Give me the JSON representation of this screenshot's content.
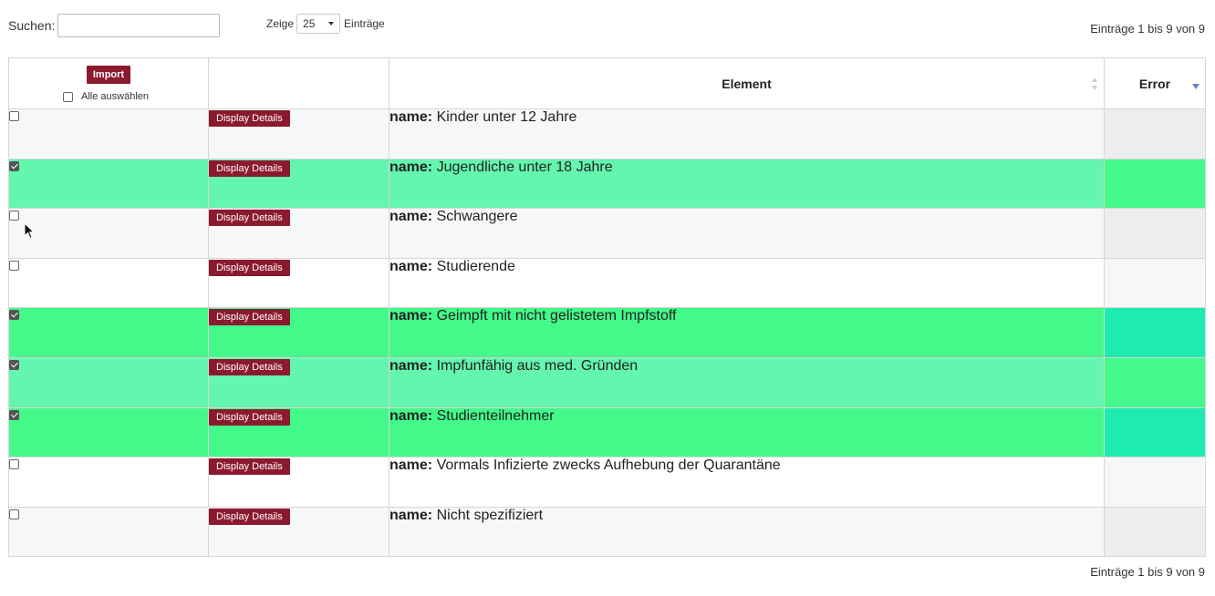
{
  "search": {
    "label": "Suchen:",
    "value": "",
    "placeholder": ""
  },
  "length": {
    "prefix": "Zeige",
    "value": "25",
    "suffix": "Einträge"
  },
  "info_top": "Einträge 1 bis 9 von 9",
  "info_bottom": "Einträge 1 bis 9 von 9",
  "header": {
    "import_label": "Import",
    "select_all_label": "Alle auswählen",
    "col_element": "Element",
    "col_error": "Error"
  },
  "row_key": "name:",
  "details_label": "Display Details",
  "colors": {
    "button": "#8b1a2f",
    "light_green": "#64f5ae",
    "green": "#43f98a",
    "teal": "#1eebb0"
  },
  "rows": [
    {
      "name": "Kinder unter 12 Jahre",
      "checked": false,
      "style": "neutral-a"
    },
    {
      "name": "Jugendliche unter 18 Jahre",
      "checked": true,
      "style": "light-green"
    },
    {
      "name": "Schwangere",
      "checked": false,
      "style": "neutral-a"
    },
    {
      "name": "Studierende",
      "checked": false,
      "style": "neutral-b"
    },
    {
      "name": "Geimpft mit nicht gelistetem Impfstoff",
      "checked": true,
      "style": "green"
    },
    {
      "name": "Impfunfähig aus med. Gründen",
      "checked": true,
      "style": "light-green"
    },
    {
      "name": "Studienteilnehmer",
      "checked": true,
      "style": "green"
    },
    {
      "name": "Vormals Infizierte zwecks Aufhebung der Quarantäne",
      "checked": false,
      "style": "neutral-b"
    },
    {
      "name": "Nicht spezifiziert",
      "checked": false,
      "style": "neutral-a"
    }
  ]
}
